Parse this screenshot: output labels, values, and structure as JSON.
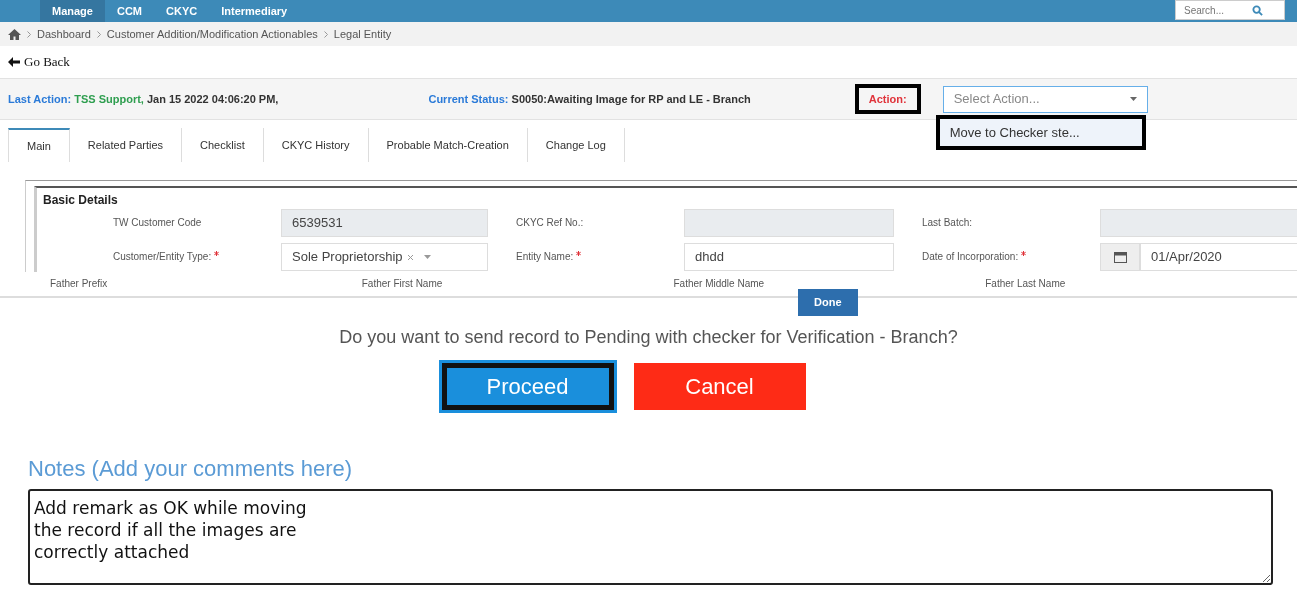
{
  "nav": {
    "items": [
      {
        "label": "Manage",
        "selected": true
      },
      {
        "label": "CCM",
        "selected": false
      },
      {
        "label": "CKYC",
        "selected": false
      },
      {
        "label": "Intermediary",
        "selected": false
      }
    ],
    "search": {
      "placeholder": "Search..."
    }
  },
  "breadcrumb": [
    "Dashboard",
    "Customer Addition/Modification Actionables",
    "Legal Entity"
  ],
  "go_back": "Go Back",
  "last_action": {
    "label": "Last Action:",
    "user": "TSS Support,",
    "time": "Jan 15 2022 04:06:20 PM,"
  },
  "current_status": {
    "label": "Current Status:",
    "value": "S0050:Awaiting Image for RP and LE - Branch"
  },
  "action": {
    "label": "Action:",
    "highlighted": true,
    "select": {
      "placeholder": "Select Action...",
      "expanded": true
    },
    "menu_items": [
      {
        "label": "Move to Checker ste...",
        "highlighted": true
      }
    ]
  },
  "tabs": [
    {
      "label": "Main",
      "selected": true
    },
    {
      "label": "Related Parties",
      "selected": false
    },
    {
      "label": "Checklist",
      "selected": false
    },
    {
      "label": "CKYC History",
      "selected": false
    },
    {
      "label": "Probable Match-Creation",
      "selected": false
    },
    {
      "label": "Change Log",
      "selected": false
    }
  ],
  "basic_details": {
    "title": "Basic Details",
    "fields": [
      {
        "label": "TW Customer Code",
        "value": "6539531",
        "kind": "text",
        "disabled": true,
        "required": false
      },
      {
        "label": "CKYC Ref No.:",
        "kind": "text",
        "disabled": true,
        "required": false
      },
      {
        "label": "Last Batch:",
        "kind": "text",
        "disabled": true,
        "required": false
      },
      {
        "label": "Customer/Entity Type:",
        "value": "Sole Proprietorship",
        "kind": "select",
        "disabled": false,
        "required": true
      },
      {
        "label": "Entity Name:",
        "value": "dhdd",
        "kind": "text",
        "disabled": false,
        "required": true
      },
      {
        "label": "Date of Incorporation:",
        "value": "01/Apr/2020",
        "kind": "date",
        "disabled": false,
        "required": true
      }
    ]
  },
  "father_labels": [
    "Father Prefix",
    "Father First Name",
    "Father Middle Name",
    "Father Last Name"
  ],
  "done_button": "Done",
  "confirm": {
    "question": "Do you want to send record to Pending with checker for Verification - Branch?",
    "buttons": [
      {
        "label": "Proceed",
        "kind": "primary",
        "highlighted": true
      },
      {
        "label": "Cancel",
        "kind": "danger",
        "highlighted": false
      }
    ]
  },
  "notes": {
    "heading": "Notes (Add your comments here)",
    "value": "Add remark as OK while moving\nthe record if all the images are\ncorrectly attached"
  }
}
